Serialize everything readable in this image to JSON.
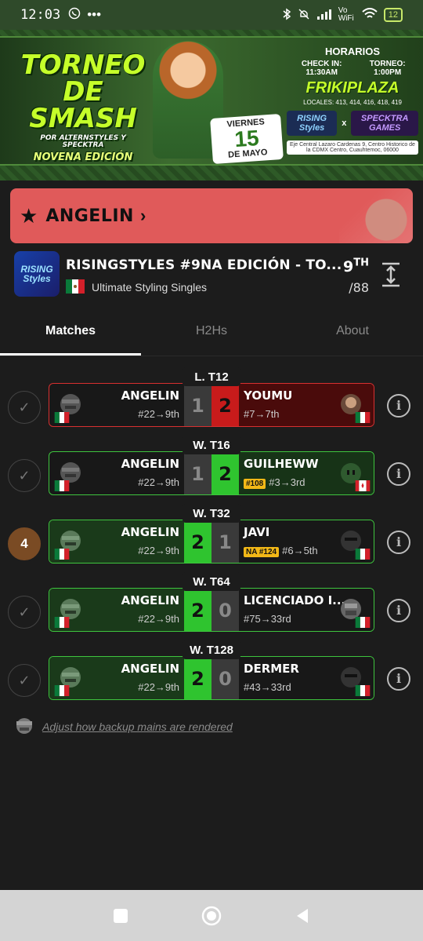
{
  "status_bar": {
    "time": "12:03",
    "network_label": "Vo WiFi",
    "battery": "12"
  },
  "banner": {
    "title": "TORNEO DE SMASH",
    "subtitle": "POR ALTERNSTYLES Y SPECKTRA",
    "edition": "NOVENA EDICIÓN",
    "day": "VIERNES",
    "date_num": "15",
    "month": "DE MAYO",
    "schedule_title": "HORARIOS",
    "checkin": "CHECK IN: 11:30AM",
    "torneo": "TORNEO: 1:00PM",
    "venue": "FRIKIPLAZA",
    "locales": "LOCALES: 413, 414, 416, 418, 419",
    "logo_left": "RISING Styles",
    "logo_x": "x",
    "logo_right": "SPECKTRA GAMES",
    "address": "Eje Central Lazaro Cardenas 9, Centro Historico de la CDMX Centro, Cuauhtemoc, 06000"
  },
  "player": {
    "name": "ANGELIN"
  },
  "tournament": {
    "logo_text": "RISING Styles",
    "name": "RISINGSTYLES #9NA EDICIÓN - TO...",
    "event": "Ultimate Styling Singles",
    "placement": "9",
    "placement_suffix": "TH",
    "total": "/88"
  },
  "tabs": [
    {
      "label": "Matches",
      "active": true
    },
    {
      "label": "H2Hs",
      "active": false
    },
    {
      "label": "About",
      "active": false
    }
  ],
  "matches": [
    {
      "round": "L. T12",
      "marker": "✓",
      "p1": "ANGELIN",
      "p1_seed": "#22→9th",
      "s1": "1",
      "s2": "2",
      "p2": "YOUMU",
      "p2_tag": "",
      "p2_seed": "#7→7th",
      "result": "loss"
    },
    {
      "round": "W. T16",
      "marker": "✓",
      "p1": "ANGELIN",
      "p1_seed": "#22→9th",
      "s1": "1",
      "s2": "2",
      "p2": "GUILHEWW",
      "p2_tag": "#108",
      "p2_seed": "#3→3rd",
      "result": "loss"
    },
    {
      "round": "W. T32",
      "marker": "4",
      "p1": "ANGELIN",
      "p1_seed": "#22→9th",
      "s1": "2",
      "s2": "1",
      "p2": "JAVI",
      "p2_tag": "NA #124",
      "p2_seed": "#6→5th",
      "result": "win"
    },
    {
      "round": "W. T64",
      "marker": "✓",
      "p1": "ANGELIN",
      "p1_seed": "#22→9th",
      "s1": "2",
      "s2": "0",
      "p2": "LICENCIADO I...",
      "p2_tag": "",
      "p2_seed": "#75→33rd",
      "result": "win"
    },
    {
      "round": "W. T128",
      "marker": "✓",
      "p1": "ANGELIN",
      "p1_seed": "#22→9th",
      "s1": "2",
      "s2": "0",
      "p2": "DERMER",
      "p2_tag": "",
      "p2_seed": "#43→33rd",
      "result": "win"
    }
  ],
  "adjust_link": "Adjust how backup mains are rendered",
  "colors": {
    "win": "#2fc42f",
    "loss": "#c81b1b",
    "player_bar": "#e05a5a",
    "tag": "#f2b817"
  }
}
